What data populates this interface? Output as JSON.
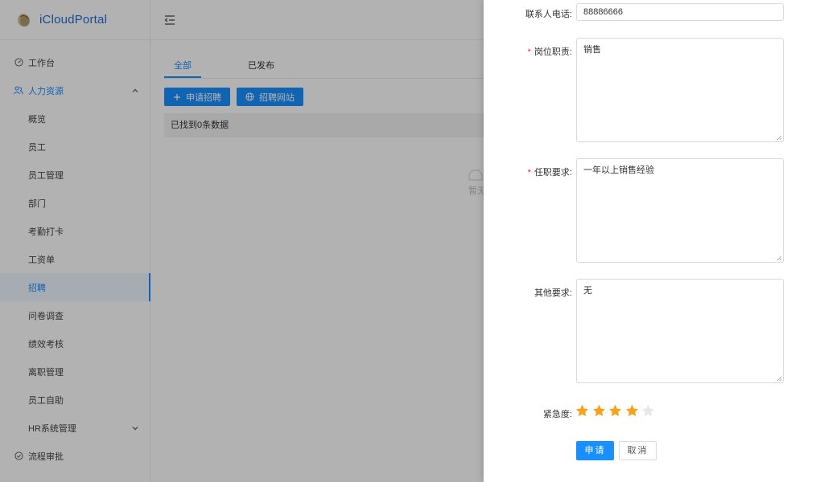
{
  "app": {
    "title": "iCloudPortal"
  },
  "sidebar": {
    "items": [
      {
        "label": "工作台",
        "icon": "dashboard-icon"
      },
      {
        "label": "人力资源",
        "icon": "team-icon"
      },
      {
        "label": "概览"
      },
      {
        "label": "员工"
      },
      {
        "label": "员工管理"
      },
      {
        "label": "部门"
      },
      {
        "label": "考勤打卡"
      },
      {
        "label": "工资单"
      },
      {
        "label": "招聘"
      },
      {
        "label": "问卷调查"
      },
      {
        "label": "绩效考核"
      },
      {
        "label": "离职管理"
      },
      {
        "label": "员工自助"
      },
      {
        "label": "HR系统管理"
      },
      {
        "label": "流程审批",
        "icon": "check-circle-icon"
      }
    ]
  },
  "main": {
    "tabs": [
      {
        "label": "全部"
      },
      {
        "label": "已发布"
      }
    ],
    "buttons": {
      "apply": "申请招聘",
      "website": "招聘网站"
    },
    "result": "已找到0条数据",
    "empty": "暂无"
  },
  "form": {
    "phone": {
      "label": "联系人电话:",
      "value": "88886666"
    },
    "duty": {
      "label": "岗位职责:",
      "value": "销售"
    },
    "requirement": {
      "label": "任职要求:",
      "value": "一年以上销售经验"
    },
    "other": {
      "label": "其他要求:",
      "value": "无"
    },
    "urgency": {
      "label": "紧急度:",
      "value": 4,
      "max": 5
    },
    "submit_label": "申请",
    "cancel_label": "取消"
  },
  "colors": {
    "primary": "#1890ff",
    "star": "#f7a21b",
    "star_empty": "#e8e8e8",
    "required": "#f5222d"
  }
}
